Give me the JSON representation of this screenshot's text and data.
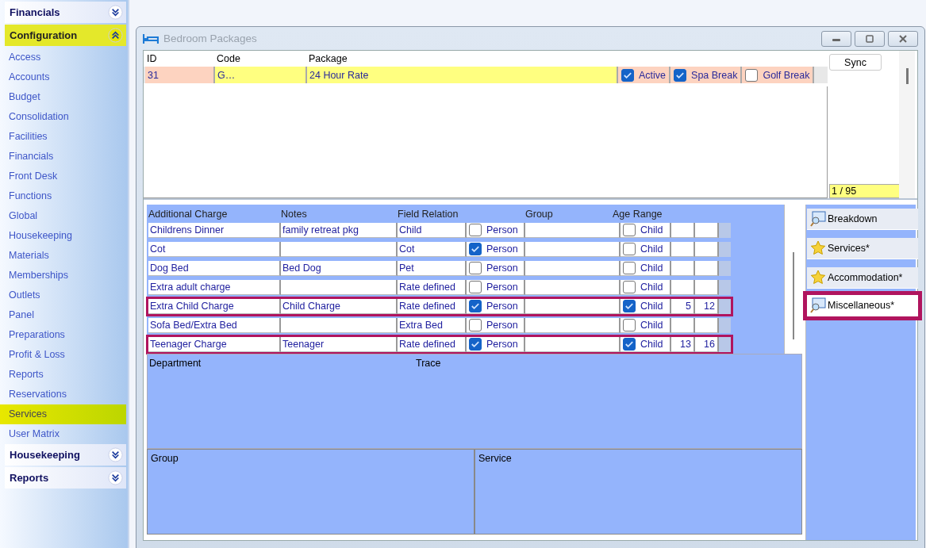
{
  "sidebar": {
    "groups": [
      {
        "label": "Financials",
        "expanded": false,
        "highlighted": false
      },
      {
        "label": "Configuration",
        "expanded": true,
        "highlighted": true,
        "items": [
          {
            "label": "Access",
            "selected": false
          },
          {
            "label": "Accounts",
            "selected": false
          },
          {
            "label": "Budget",
            "selected": false
          },
          {
            "label": "Consolidation",
            "selected": false
          },
          {
            "label": "Facilities",
            "selected": false
          },
          {
            "label": "Financials",
            "selected": false
          },
          {
            "label": "Front Desk",
            "selected": false
          },
          {
            "label": "Functions",
            "selected": false
          },
          {
            "label": "Global",
            "selected": false
          },
          {
            "label": "Housekeeping",
            "selected": false
          },
          {
            "label": "Materials",
            "selected": false
          },
          {
            "label": "Memberships",
            "selected": false
          },
          {
            "label": "Outlets",
            "selected": false
          },
          {
            "label": "Panel",
            "selected": false
          },
          {
            "label": "Preparations",
            "selected": false
          },
          {
            "label": "Profit & Loss",
            "selected": false
          },
          {
            "label": "Reports",
            "selected": false
          },
          {
            "label": "Reservations",
            "selected": false
          },
          {
            "label": "Services",
            "selected": true
          },
          {
            "label": "User Matrix",
            "selected": false
          }
        ]
      },
      {
        "label": "Housekeeping",
        "expanded": false,
        "highlighted": false
      },
      {
        "label": "Reports",
        "expanded": false,
        "highlighted": false
      }
    ]
  },
  "window": {
    "title": "Bedroom Packages"
  },
  "packages": {
    "columns": [
      "ID",
      "Code",
      "Package"
    ],
    "row": {
      "id": "31",
      "code": "G…",
      "package": "24 Hour Rate",
      "flags": [
        {
          "label": "Active",
          "checked": true
        },
        {
          "label": "Spa Break",
          "checked": true
        },
        {
          "label": "Golf Break",
          "checked": false
        }
      ]
    },
    "sync_button": "Sync",
    "counter": "1 / 95"
  },
  "charges": {
    "columns": [
      "Additional Charge",
      "Notes",
      "Field Relation",
      "Group",
      "Age Range"
    ],
    "rows": [
      {
        "charge": "Childrens Dinner",
        "notes": "family retreat pkg",
        "relation": "Child",
        "person_label": "Person",
        "person": false,
        "child_label": "Child",
        "child": false,
        "age_from": "",
        "age_to": "",
        "highlighted": false
      },
      {
        "charge": "Cot",
        "notes": "",
        "relation": "Cot",
        "person_label": "Person",
        "person": true,
        "child_label": "Child",
        "child": false,
        "age_from": "",
        "age_to": "",
        "highlighted": false
      },
      {
        "charge": "Dog Bed",
        "notes": "Bed Dog",
        "relation": "Pet",
        "person_label": "Person",
        "person": false,
        "child_label": "Child",
        "child": false,
        "age_from": "",
        "age_to": "",
        "highlighted": false
      },
      {
        "charge": "Extra adult charge",
        "notes": "",
        "relation": "Rate defined",
        "person_label": "Person",
        "person": false,
        "child_label": "Child",
        "child": false,
        "age_from": "",
        "age_to": "",
        "highlighted": false
      },
      {
        "charge": "Extra Child Charge",
        "notes": "Child Charge",
        "relation": "Rate defined",
        "person_label": "Person",
        "person": true,
        "child_label": "Child",
        "child": true,
        "age_from": "5",
        "age_to": "12",
        "highlighted": true
      },
      {
        "charge": "Sofa Bed/Extra Bed",
        "notes": "",
        "relation": "Extra Bed",
        "person_label": "Person",
        "person": false,
        "child_label": "Child",
        "child": false,
        "age_from": "",
        "age_to": "",
        "highlighted": false
      },
      {
        "charge": "Teenager Charge",
        "notes": "Teenager",
        "relation": "Rate defined",
        "person_label": "Person",
        "person": true,
        "child_label": "Child",
        "child": true,
        "age_from": "13",
        "age_to": "16",
        "highlighted": true
      }
    ]
  },
  "tabs": [
    {
      "label": "Breakdown",
      "kind": "search",
      "selected": false,
      "highlighted": false
    },
    {
      "label": "Services*",
      "kind": "star",
      "selected": false,
      "highlighted": false
    },
    {
      "label": "Accommodation*",
      "kind": "star",
      "selected": false,
      "highlighted": false
    },
    {
      "label": "Miscellaneous*",
      "kind": "search",
      "selected": true,
      "highlighted": true
    }
  ],
  "department_panel": {
    "labels": [
      "Department",
      "Trace"
    ]
  },
  "bottom_panels": [
    {
      "label": "Group"
    },
    {
      "label": "Service"
    }
  ]
}
